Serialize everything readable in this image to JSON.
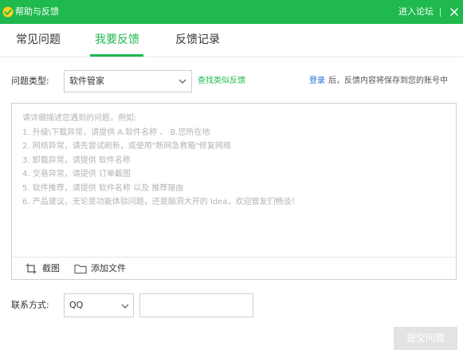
{
  "window": {
    "title": "帮助与反馈",
    "forum_link": "进入论坛"
  },
  "tabs": [
    {
      "label": "常见问题",
      "active": false
    },
    {
      "label": "我要反馈",
      "active": true
    },
    {
      "label": "反馈记录",
      "active": false
    }
  ],
  "form": {
    "type_label": "问题类型:",
    "type_value": "软件管家",
    "similar_link": "查找类似反馈",
    "login_link": "登录",
    "login_note": "后，反馈内容将保存到您的账号中",
    "editor_placeholder": "请详细描述您遇到的问题，例如:\n1. 升级\\下载异常，请提供 A.软件名称 、 B.您所在地\n2. 网络异常，请先尝试刷新，或使用\"断网急救箱\"修复网络\n3. 卸载异常，请提供 软件名称\n4. 交易异常，请提供 订单截图\n5. 软件推荐，请提供 软件名称 以及 推荐理由\n6. 产品建议，无论是功能体验问题，还是脑洞大开的 Idea，欢迎管友们畅谈！",
    "screenshot_label": "截图",
    "attach_label": "添加文件",
    "contact_label": "联系方式:",
    "contact_type": "QQ",
    "contact_value": "",
    "submit_label": "提交问题"
  },
  "colors": {
    "brand_green": "#1fb94e",
    "link_blue": "#1a6fd6",
    "disabled_button": "#e3e3e3"
  },
  "icons": {
    "app_logo": "app-logo-icon",
    "close": "close-icon",
    "dropdown": "chevron-down-icon",
    "crop": "crop-icon",
    "folder": "folder-icon"
  }
}
